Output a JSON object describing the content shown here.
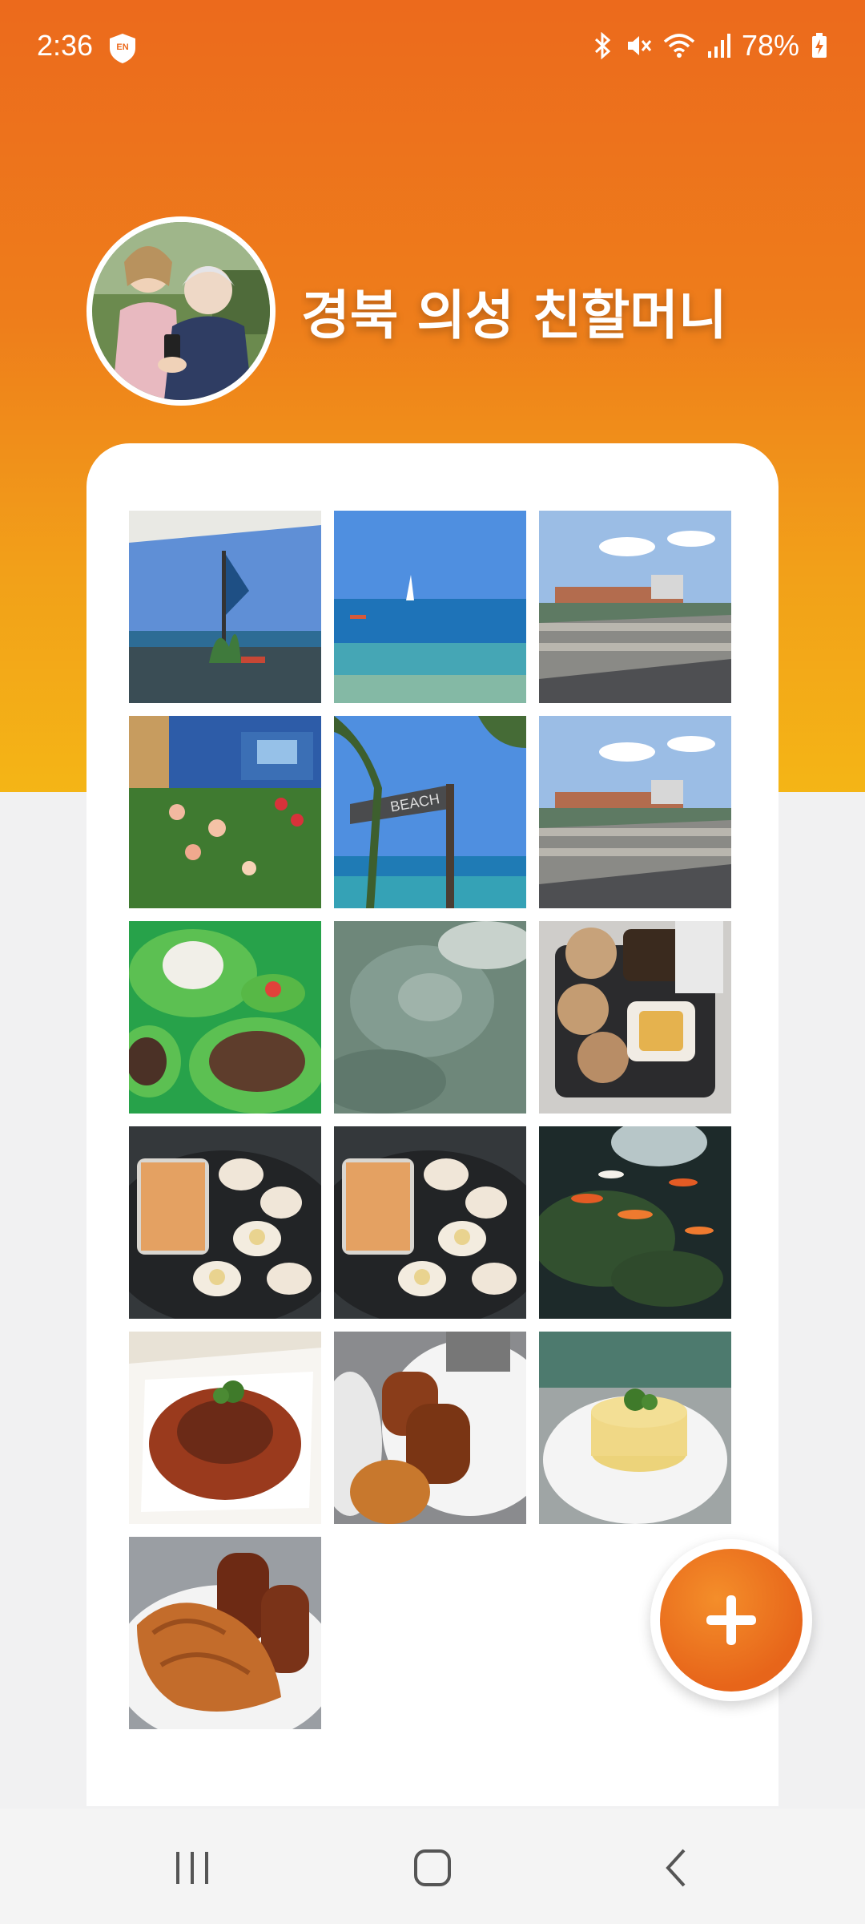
{
  "status_bar": {
    "time": "2:36",
    "battery_percent": "78%",
    "icons": [
      "vpn-shield-icon",
      "bluetooth-icon",
      "mute-icon",
      "wifi-icon",
      "signal-icon",
      "battery-charging-icon"
    ]
  },
  "album": {
    "title": "경북 의성 친할머니",
    "avatar_icon": "profile-photo"
  },
  "photos": [
    {
      "name": "photo-harbor-flag",
      "scene": "harbor"
    },
    {
      "name": "photo-sea-boats",
      "scene": "sea"
    },
    {
      "name": "photo-bridge-road-1",
      "scene": "bridge"
    },
    {
      "name": "photo-blue-house-flowers",
      "scene": "garden"
    },
    {
      "name": "photo-beach-sign",
      "scene": "beach-sign"
    },
    {
      "name": "photo-bridge-road-2",
      "scene": "bridge"
    },
    {
      "name": "photo-rice-meat-plates",
      "scene": "meal"
    },
    {
      "name": "photo-water-surface",
      "scene": "water"
    },
    {
      "name": "photo-coffee-waffles",
      "scene": "coffee"
    },
    {
      "name": "photo-grilled-scallops-1",
      "scene": "scallops"
    },
    {
      "name": "photo-grilled-scallops-2",
      "scene": "scallops"
    },
    {
      "name": "photo-koi-pond",
      "scene": "koi"
    },
    {
      "name": "photo-stew-dish",
      "scene": "stew"
    },
    {
      "name": "photo-canele-plate",
      "scene": "canele"
    },
    {
      "name": "photo-mashed-potato",
      "scene": "potato"
    },
    {
      "name": "photo-croissant-canele",
      "scene": "croissant"
    }
  ],
  "fab": {
    "icon": "plus-icon"
  },
  "nav_bar": {
    "icons": [
      "recent-apps-icon",
      "home-icon",
      "back-icon"
    ]
  }
}
